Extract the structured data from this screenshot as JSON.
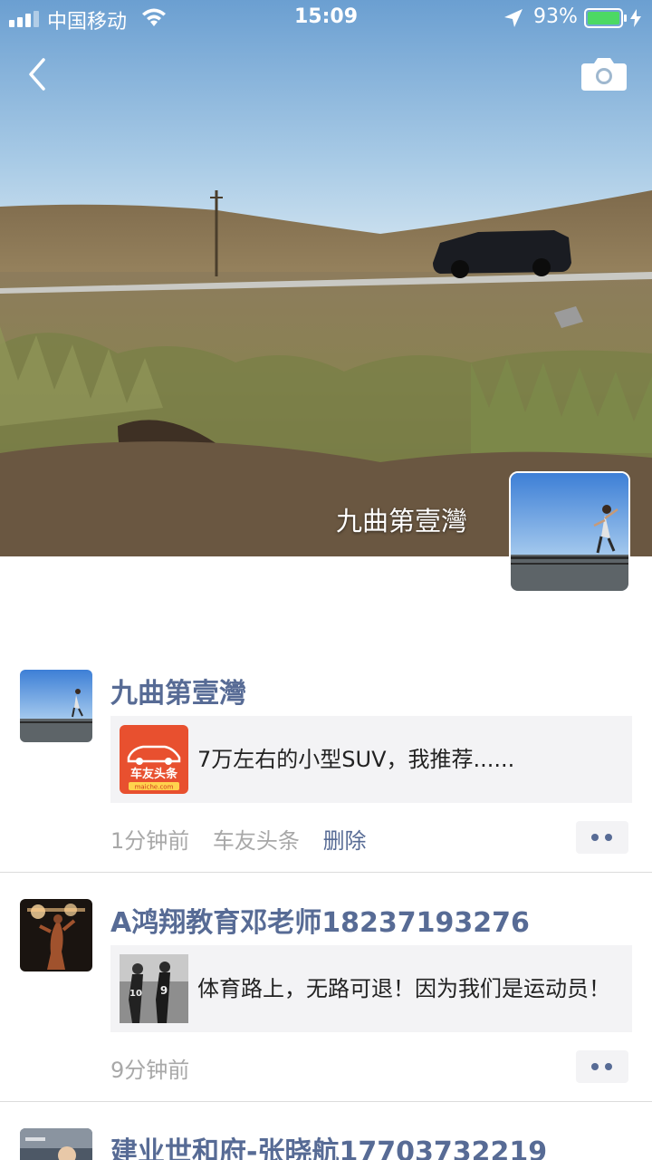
{
  "status_bar": {
    "carrier": "中国移动",
    "time": "15:09",
    "battery": "93%"
  },
  "header": {
    "back_icon": "chevron-left-icon",
    "camera_icon": "camera-icon"
  },
  "profile": {
    "name": "九曲第壹灣"
  },
  "posts": [
    {
      "name": "九曲第壹灣",
      "share": {
        "thumb_label": "车友头条",
        "thumb_sublabel": "maiche.com",
        "text": "7万左右的小型SUV，我推荐......"
      },
      "time": "1分钟前",
      "source": "车友头条",
      "delete_label": "删除"
    },
    {
      "name": "A鸿翔教育邓老师18237193276",
      "share": {
        "text": "体育路上，无路可退！因为我们是运动员！"
      },
      "time": "9分钟前"
    },
    {
      "name": "建业世和府-张晓航17703732219"
    }
  ],
  "colors": {
    "link": "#576b95",
    "accent_red": "#e8502f",
    "battery_green": "#4cd964"
  }
}
